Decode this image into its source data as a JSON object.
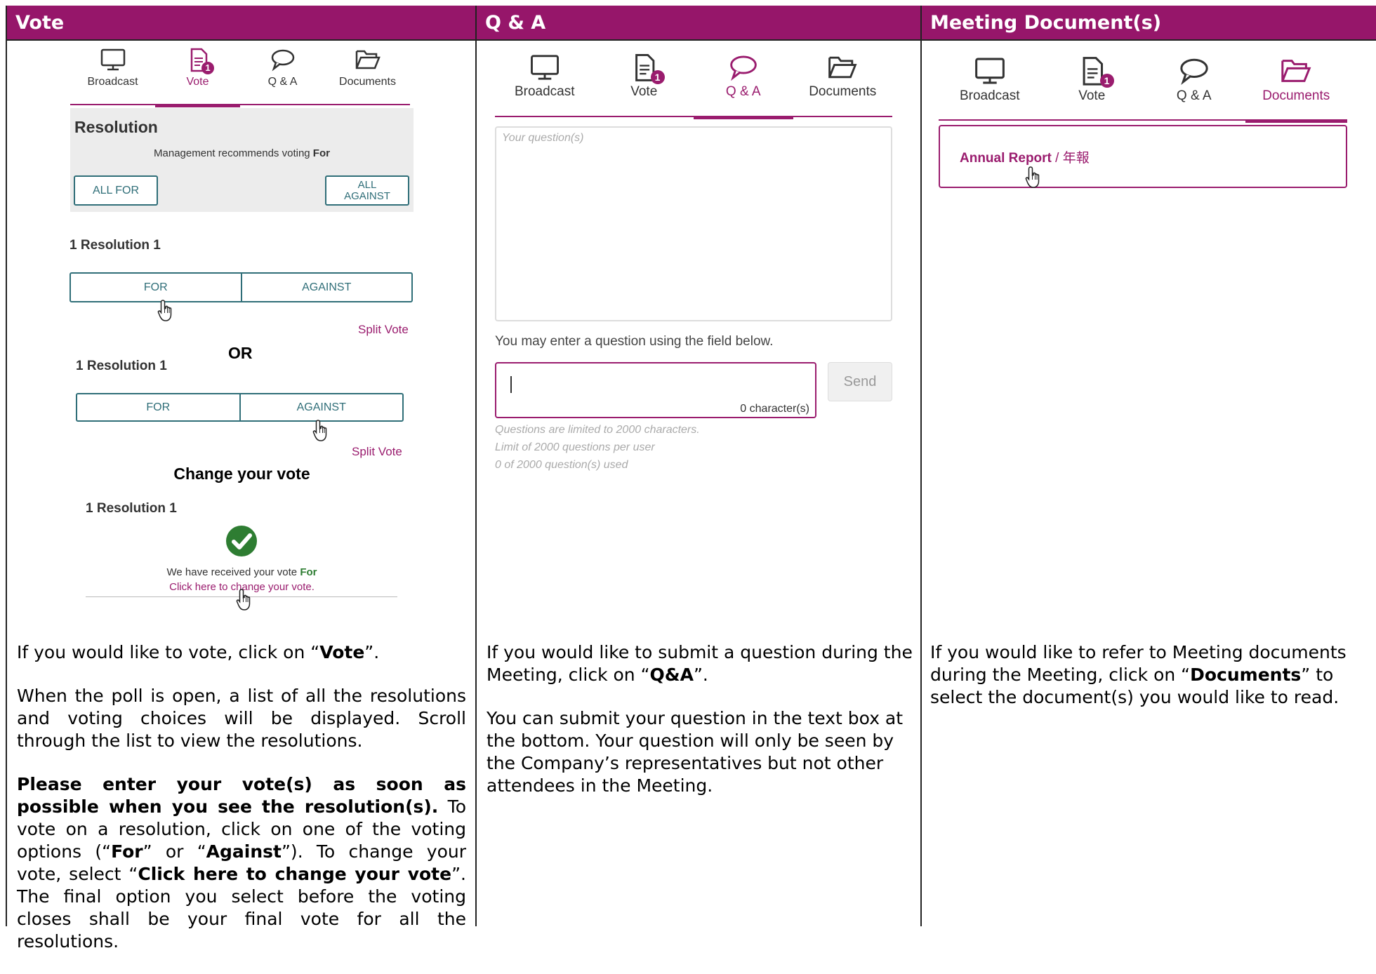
{
  "headers": {
    "vote": "Vote",
    "qa": "Q & A",
    "docs": "Meeting Document(s)"
  },
  "tabs": {
    "broadcast": "Broadcast",
    "vote": "Vote",
    "qa": "Q & A",
    "documents": "Documents",
    "vote_badge": "1"
  },
  "vote_panel": {
    "resolution_title": "Resolution",
    "recommend_prefix": "Management recommends voting ",
    "recommend_value": "For",
    "all_for": "ALL FOR",
    "all_against_1": "ALL",
    "all_against_2": "AGAINST",
    "resolution_label": "1 Resolution 1",
    "for": "FOR",
    "against": "AGAINST",
    "split_vote": "Split Vote",
    "or": "OR",
    "change_heading": "Change your vote",
    "received_prefix": "We have received your vote ",
    "received_value": "For",
    "change_link": "Click here to change your vote."
  },
  "qa_panel": {
    "question_placeholder": "Your question(s)",
    "hint": "You may enter a question using the field below.",
    "char_count": "0 character(s)",
    "send": "Send",
    "limit1": "Questions are limited to 2000 characters.",
    "limit2": "Limit of 2000 questions per user",
    "limit3": "0 of 2000 question(s) used"
  },
  "docs_panel": {
    "doc_name": "Annual Report",
    "doc_suffix": " / 年報"
  },
  "text": {
    "vote_p1_a": "If you would like to vote, click on “",
    "vote_p1_b": "Vote",
    "vote_p1_c": "”.",
    "vote_p2": "When the poll is open, a list of all the resolutions and voting choices will be displayed. Scroll through the list to view the resolutions.",
    "vote_p3_bold": "Please enter your vote(s) as soon as possible when you see the resolution(s).",
    "vote_p3_a": " To vote on a resolution, click on one of the voting options (“",
    "vote_p3_for": "For",
    "vote_p3_b": "” or “",
    "vote_p3_against": "Against",
    "vote_p3_c": "”). To change your vote, select “",
    "vote_p3_click": "Click here to change your vote",
    "vote_p3_d": "”. The final option you select before the voting closes shall be your final vote for all the resolutions.",
    "qa_p1_a": "If you would like to submit a question during the Meeting, click on “",
    "qa_p1_b": "Q&A",
    "qa_p1_c": "”.",
    "qa_p2": "You can submit your question in the text box at the bottom. Your question will only be seen by the Company’s representatives but not other attendees in the Meeting.",
    "doc_p1_a": "If you would like to refer to Meeting documents during the Meeting, click on “",
    "doc_p1_b": "Documents",
    "doc_p1_c": "” to select the document(s) you would like to read."
  }
}
